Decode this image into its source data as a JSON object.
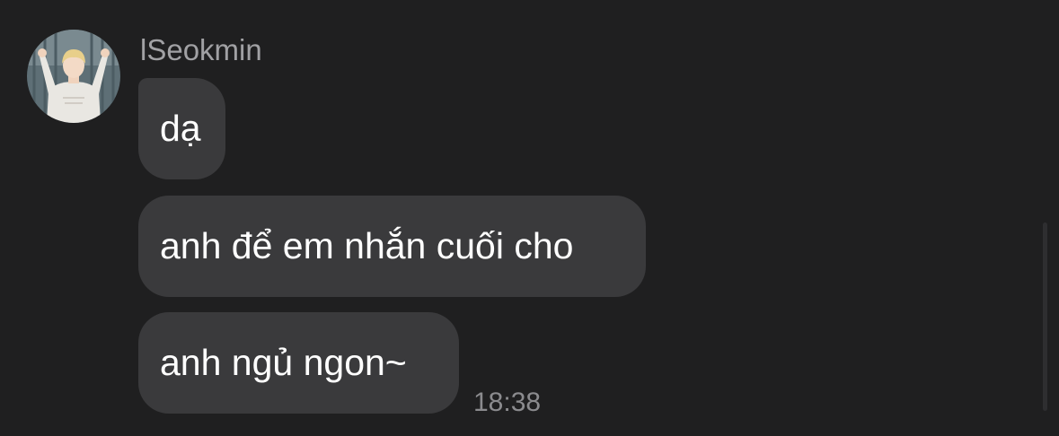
{
  "conversation": {
    "sender": {
      "name": "lSeokmin",
      "avatar_icon": "user-avatar-photo"
    },
    "messages": [
      {
        "text": "dạ"
      },
      {
        "text": "anh để em nhắn cuối cho"
      },
      {
        "text": "anh ngủ ngon~"
      }
    ],
    "last_message_time": "18:38"
  },
  "colors": {
    "background": "#1f1f20",
    "bubble": "#3a3a3c",
    "message_text": "#ffffff",
    "sender_name": "#a1a1a4",
    "timestamp": "#8b8b8e"
  }
}
